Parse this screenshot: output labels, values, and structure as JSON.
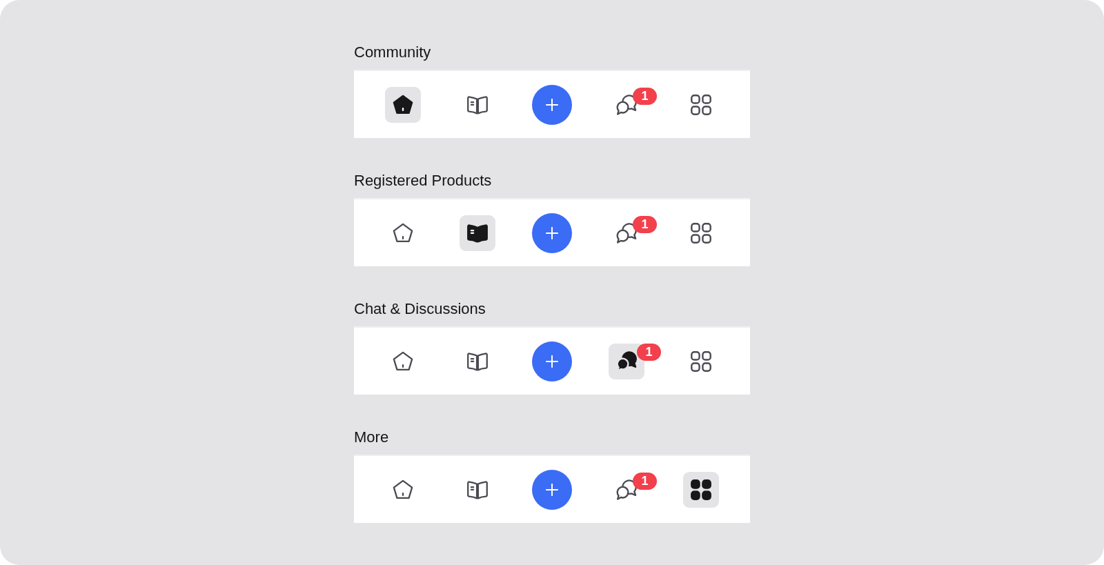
{
  "sections": [
    {
      "title": "Community",
      "nav_items": [
        {
          "kind": "home",
          "selected": true
        },
        {
          "kind": "book",
          "selected": false
        },
        {
          "kind": "add",
          "selected": false
        },
        {
          "kind": "chat",
          "selected": false,
          "badge": "1"
        },
        {
          "kind": "grid",
          "selected": false
        }
      ]
    },
    {
      "title": "Registered Products",
      "nav_items": [
        {
          "kind": "home",
          "selected": false
        },
        {
          "kind": "book",
          "selected": true
        },
        {
          "kind": "add",
          "selected": false
        },
        {
          "kind": "chat",
          "selected": false,
          "badge": "1"
        },
        {
          "kind": "grid",
          "selected": false
        }
      ]
    },
    {
      "title": "Chat & Discussions",
      "nav_items": [
        {
          "kind": "home",
          "selected": false
        },
        {
          "kind": "book",
          "selected": false
        },
        {
          "kind": "add",
          "selected": false
        },
        {
          "kind": "chat",
          "selected": true,
          "badge": "1"
        },
        {
          "kind": "grid",
          "selected": false
        }
      ]
    },
    {
      "title": "More",
      "nav_items": [
        {
          "kind": "home",
          "selected": false
        },
        {
          "kind": "book",
          "selected": false
        },
        {
          "kind": "add",
          "selected": false
        },
        {
          "kind": "chat",
          "selected": false,
          "badge": "1"
        },
        {
          "kind": "grid",
          "selected": true
        }
      ]
    }
  ]
}
